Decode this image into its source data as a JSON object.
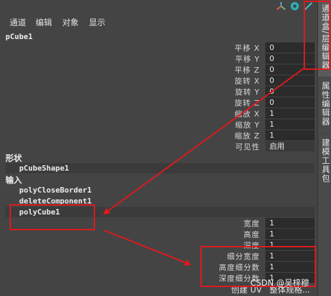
{
  "menu": [
    "通道",
    "编辑",
    "对象",
    "显示"
  ],
  "node_name": "pCube1",
  "transform_attrs": [
    {
      "label": "平移 X",
      "value": "0"
    },
    {
      "label": "平移 Y",
      "value": "0"
    },
    {
      "label": "平移 Z",
      "value": "0"
    },
    {
      "label": "旋转 X",
      "value": "0"
    },
    {
      "label": "旋转 Y",
      "value": "0"
    },
    {
      "label": "旋转 Z",
      "value": "0"
    },
    {
      "label": "缩放 X",
      "value": "1"
    },
    {
      "label": "缩放 Y",
      "value": "1"
    },
    {
      "label": "缩放 Z",
      "value": "1"
    },
    {
      "label": "可见性",
      "value": "启用"
    }
  ],
  "shapes": {
    "heading": "形状",
    "item": "pCubeShape1"
  },
  "inputs": {
    "heading": "输入",
    "items": [
      "polyCloseBorder1",
      "deleteComponent1",
      "polyCube1"
    ]
  },
  "poly_attrs": [
    {
      "label": "宽度",
      "value": "1"
    },
    {
      "label": "高度",
      "value": "1"
    },
    {
      "label": "深度",
      "value": "1"
    },
    {
      "label": "细分宽度",
      "value": "1"
    },
    {
      "label": "高度细分数",
      "value": "1"
    },
    {
      "label": "深度细分数",
      "value": "1"
    }
  ],
  "bottom": {
    "create_uv": "创建 UV",
    "uv_value": "整体规格..."
  },
  "tabs": [
    "通道盒/层编辑器",
    "属性编辑器",
    "建模工具包"
  ],
  "watermark": "CSDN @吴梓穆",
  "colors": {
    "annotation": "#e0191d",
    "background": "#444444",
    "field": "#2b2b2b"
  },
  "icons": [
    "axis-icon",
    "teal-circle-icon",
    "pencil-icon"
  ]
}
